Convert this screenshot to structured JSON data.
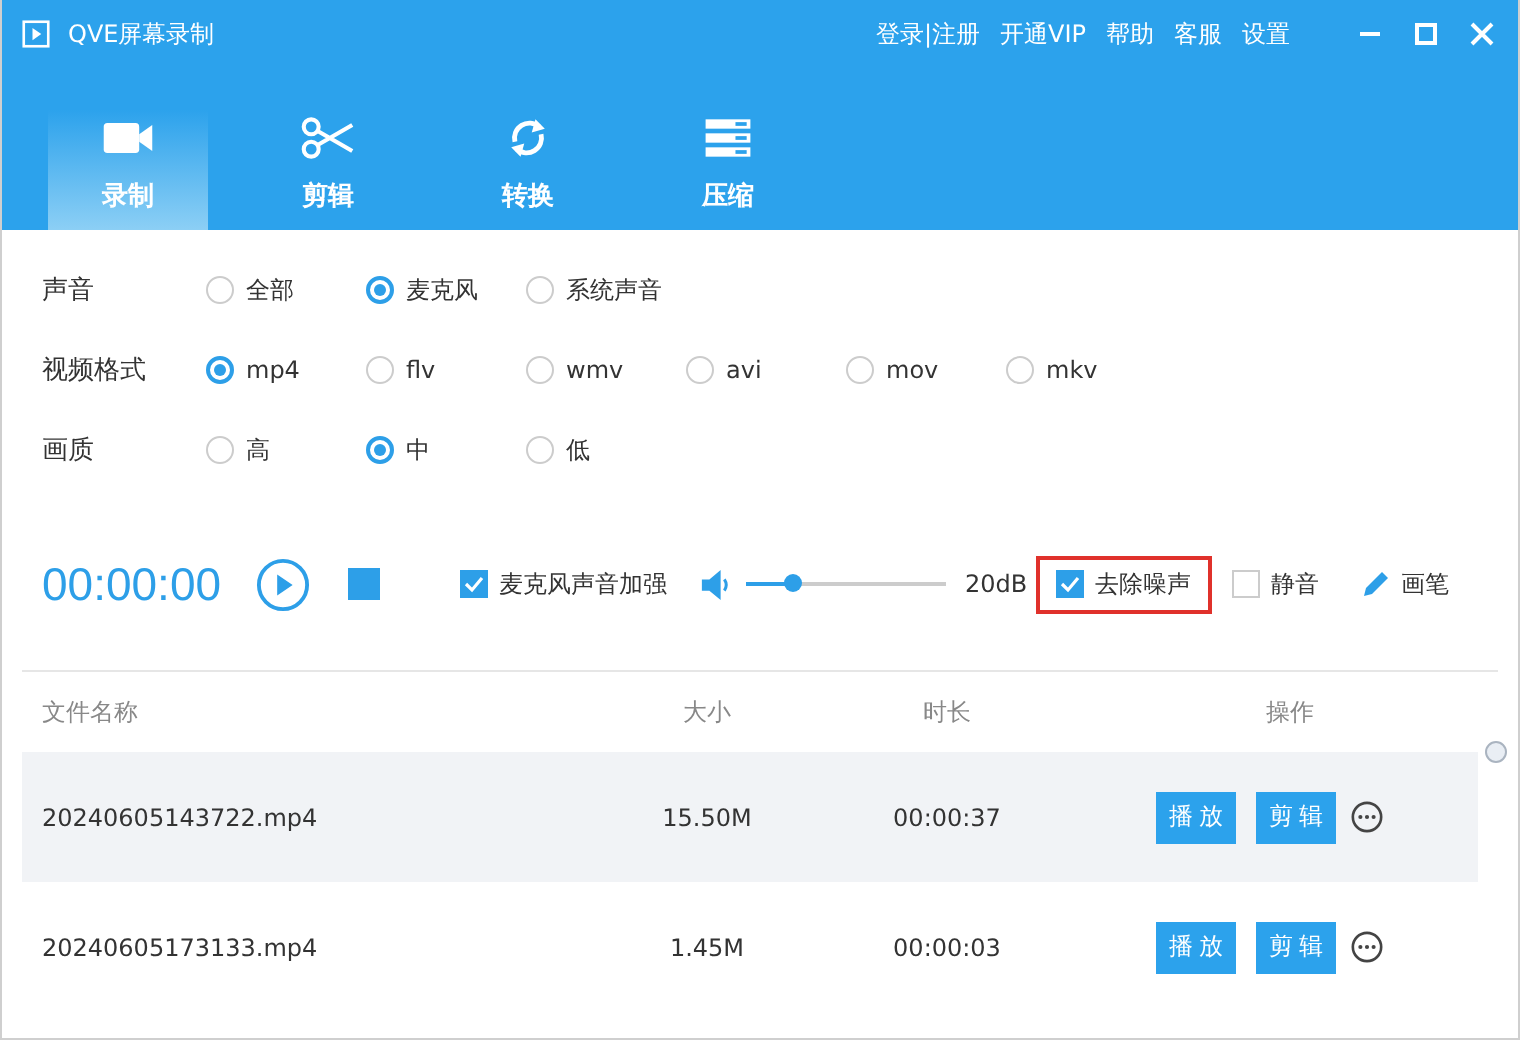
{
  "window": {
    "title": "QVE屏幕录制",
    "links": [
      "登录|注册",
      "开通VIP",
      "帮助",
      "客服",
      "设置"
    ]
  },
  "tabs": [
    {
      "label": "录制",
      "selected": true
    },
    {
      "label": "剪辑",
      "selected": false
    },
    {
      "label": "转换",
      "selected": false
    },
    {
      "label": "压缩",
      "selected": false
    }
  ],
  "option_groups": [
    {
      "label": "声音",
      "options": [
        {
          "label": "全部",
          "selected": false
        },
        {
          "label": "麦克风",
          "selected": true
        },
        {
          "label": "系统声音",
          "selected": false
        }
      ]
    },
    {
      "label": "视频格式",
      "options": [
        {
          "label": "mp4",
          "selected": true
        },
        {
          "label": "flv",
          "selected": false
        },
        {
          "label": "wmv",
          "selected": false
        },
        {
          "label": "avi",
          "selected": false
        },
        {
          "label": "mov",
          "selected": false
        },
        {
          "label": "mkv",
          "selected": false
        }
      ]
    },
    {
      "label": "画质",
      "options": [
        {
          "label": "高",
          "selected": false
        },
        {
          "label": "中",
          "selected": true
        },
        {
          "label": "低",
          "selected": false
        }
      ]
    }
  ],
  "recorder": {
    "timer": "00:00:00",
    "mic_boost": {
      "label": "麦克风声音加强",
      "checked": true
    },
    "volume": {
      "level": 0.23,
      "reading": "20dB"
    },
    "denoise": {
      "label": "去除噪声",
      "checked": true,
      "highlighted": true
    },
    "mute": {
      "label": "静音",
      "checked": false
    },
    "pen": {
      "label": "画笔"
    }
  },
  "table": {
    "columns": [
      "文件名称",
      "大小",
      "时长",
      "操作"
    ],
    "rows": [
      {
        "name": "20240605143722.mp4",
        "size": "15.50M",
        "duration": "00:00:37",
        "selected": true,
        "actions": [
          "播放",
          "剪辑"
        ]
      },
      {
        "name": "20240605173133.mp4",
        "size": "1.45M",
        "duration": "00:00:03",
        "selected": false,
        "actions": [
          "播放",
          "剪辑"
        ]
      }
    ]
  }
}
